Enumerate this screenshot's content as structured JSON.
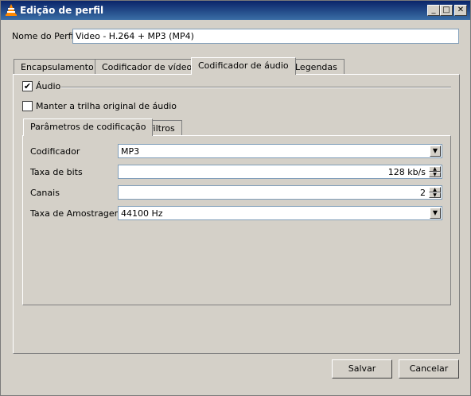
{
  "window": {
    "title": "Edição de perfil",
    "controls": {
      "minimize": "_",
      "maximize": "□",
      "close": "✕"
    }
  },
  "profile": {
    "name_label": "Nome do Perfil",
    "name_value": "Video - H.264 + MP3 (MP4)"
  },
  "tabs": [
    {
      "label": "Encapsulamento",
      "active": false
    },
    {
      "label": "Codificador de vídeo",
      "active": false
    },
    {
      "label": "Codificador de áudio",
      "active": true
    },
    {
      "label": "Legendas",
      "active": false
    }
  ],
  "audio": {
    "enable_label": "Áudio",
    "enable_checked": true,
    "keep_track_label": "Manter a trilha original de áudio",
    "keep_track_checked": false
  },
  "subtabs": [
    {
      "label": "Parâmetros de codificação",
      "active": true
    },
    {
      "label": "Filtros",
      "active": false
    }
  ],
  "params": {
    "codec_label": "Codificador",
    "codec_value": "MP3",
    "bitrate_label": "Taxa de bits",
    "bitrate_value": "128 kb/s",
    "channels_label": "Canais",
    "channels_value": "2",
    "samplerate_label": "Taxa de Amostragem",
    "samplerate_value": "44100 Hz"
  },
  "buttons": {
    "save": "Salvar",
    "cancel": "Cancelar"
  }
}
